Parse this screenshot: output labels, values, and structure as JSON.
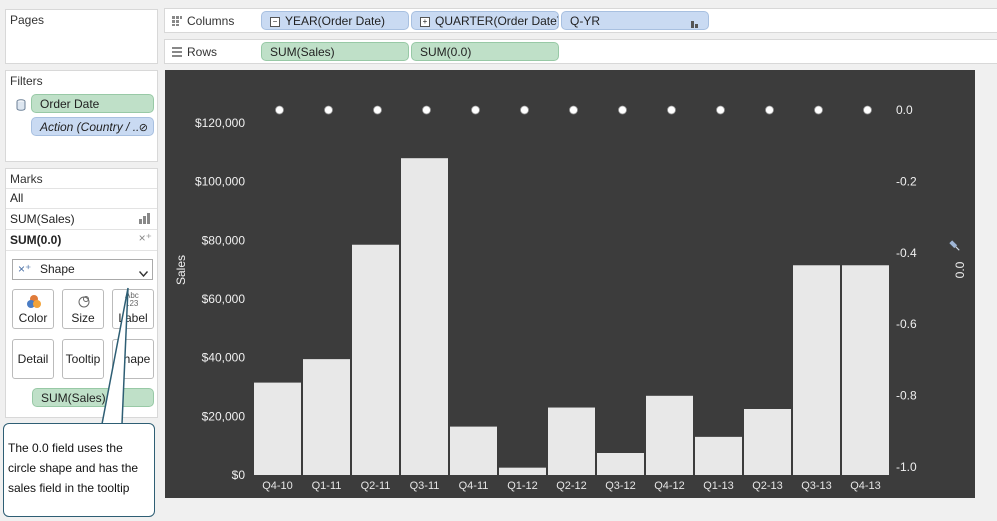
{
  "pages": {
    "title": "Pages"
  },
  "filters": {
    "title": "Filters",
    "items": [
      "Order Date",
      "Action (Country / .."
    ]
  },
  "marks": {
    "title": "Marks",
    "rows": [
      "All",
      "SUM(Sales)",
      "SUM(0.0)"
    ],
    "mark_type": "Shape",
    "buttons": [
      "Color",
      "Size",
      "Label",
      "Detail",
      "Tooltip",
      "Shape"
    ],
    "tooltip_pill": "SUM(Sales)"
  },
  "columns": {
    "label": "Columns",
    "pills": [
      "YEAR(Order Date)",
      "QUARTER(Order Date)",
      "Q-YR"
    ]
  },
  "rows": {
    "label": "Rows",
    "pills": [
      "SUM(Sales)",
      "SUM(0.0)"
    ]
  },
  "callout": {
    "text": "The 0.0 field uses the circle shape and has the sales field in the tooltip"
  },
  "colors": {
    "chart_bg": "#3c3c3c",
    "bar": "#e8e8e8",
    "pill_blue": "#c9daf2",
    "pill_green": "#bfe0c8",
    "callout_border": "#2e5e74"
  },
  "chart_data": {
    "type": "bar",
    "categories": [
      "Q4-10",
      "Q1-11",
      "Q2-11",
      "Q3-11",
      "Q4-11",
      "Q1-12",
      "Q2-12",
      "Q3-12",
      "Q4-12",
      "Q1-13",
      "Q2-13",
      "Q3-13",
      "Q4-13"
    ],
    "series": [
      {
        "name": "Sales",
        "values": [
          31500,
          39500,
          78500,
          108000,
          16500,
          2500,
          23000,
          7500,
          27000,
          13000,
          22500,
          71500,
          71500
        ]
      },
      {
        "name": "0.0",
        "values": [
          0,
          0,
          0,
          0,
          0,
          0,
          0,
          0,
          0,
          0,
          0,
          0,
          0
        ]
      }
    ],
    "ylabel": "Sales",
    "y2label": "0.0",
    "ylim": [
      0,
      120000
    ],
    "y2lim": [
      -1.0,
      0.0
    ],
    "yticks": [
      "$120,000",
      "$100,000",
      "$80,000",
      "$60,000",
      "$40,000",
      "$20,000",
      "$0"
    ],
    "y2ticks": [
      "0.0",
      "-0.2",
      "-0.4",
      "-0.6",
      "-0.8",
      "-1.0"
    ],
    "grid": false
  }
}
